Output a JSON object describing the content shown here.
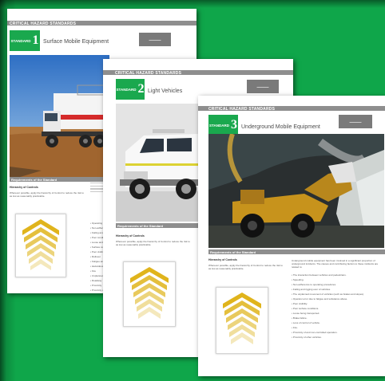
{
  "pages": [
    {
      "category": "CRITICAL HAZARD STANDARDS",
      "standard_word": "STANDARD",
      "number": "1",
      "title": "Surface Mobile Equipment",
      "requirements_heading": "Requirements of the Standard",
      "hierarchy_heading": "Hierarchy of Controls",
      "hierarchy_text": "Wherever possible, apply the hierarchy of Control to reduce the risk to as low as reasonably practicable.",
      "bullets": [
        "• Operating",
        "• Non-adherence",
        "• Failing and rigging",
        "• Poor conditions",
        "• Loose and falling",
        "• Surface conditions",
        "• Poor visibility",
        "• Rollover",
        "• Fatigue and",
        "• Hazardous",
        "• Fire",
        "• Unplanned",
        "• Roadway",
        "• Proximity",
        "• Proximity of"
      ]
    },
    {
      "category": "CRITICAL HAZARD STANDARDS",
      "standard_word": "STANDARD",
      "number": "2",
      "title": "Light Vehicles",
      "requirements_heading": "Requirements of the Standard",
      "hierarchy_heading": "Hierarchy of Controls",
      "hierarchy_text": "Wherever possible, apply the hierarchy of Control to reduce the risk to as low as reasonably practicable."
    },
    {
      "category": "CRITICAL HAZARD STANDARDS",
      "standard_word": "STANDARD",
      "number": "3",
      "title": "Underground Mobile Equipment",
      "requirements_heading": "Requirements of the Standard",
      "hierarchy_heading": "Hierarchy of Controls",
      "hierarchy_text": "Wherever possible, apply the hierarchy of Control to reduce the risk to as low as reasonably practicable.",
      "intro_text": "Underground mobile equipment has been involved in a significant proportion of underground incidents. The causes and contributing factors to these incidents are related to:",
      "bullets": [
        "• The interaction between vehicles and pedestrians.",
        "• Speeding.",
        "• Non-adherence to operating procedures.",
        "• Failing and rigging over of vehicles.",
        "• The unplanned movement of vehicles (such as brakes and slopes).",
        "• Operator error due to fatigue and substance abuse.",
        "• Poor visibility.",
        "• Poor surface conditions.",
        "• Loose being transported.",
        "• Brake failure.",
        "• Loss of control of vehicle.",
        "• Fire.",
        "• Proximity of and non-controlled operation.",
        "• Proximity of other vehicles."
      ]
    }
  ],
  "colors": {
    "background": "#0fa64a",
    "accent": "#1aa84e",
    "band": "#8e8e8e",
    "chevron": "#e0b41c"
  }
}
